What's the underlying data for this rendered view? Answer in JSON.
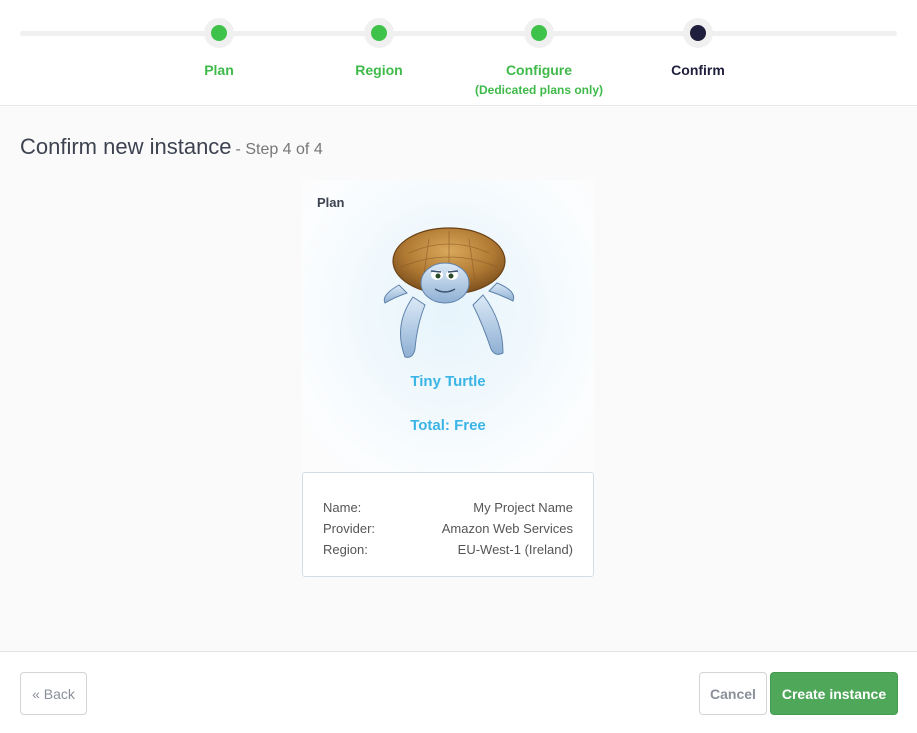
{
  "stepper": {
    "steps": [
      {
        "label": "Plan",
        "sub": "",
        "state": "done"
      },
      {
        "label": "Region",
        "sub": "",
        "state": "done"
      },
      {
        "label": "Configure",
        "sub": "(Dedicated plans only)",
        "state": "done"
      },
      {
        "label": "Confirm",
        "sub": "",
        "state": "active"
      }
    ]
  },
  "heading": {
    "title": "Confirm new instance",
    "step_text": "- Step 4 of 4"
  },
  "plan_card": {
    "label": "Plan",
    "plan_name": "Tiny Turtle",
    "total": "Total: Free",
    "image": "turtle-mascot"
  },
  "details": {
    "rows": [
      {
        "key": "Name:",
        "value": "My Project Name"
      },
      {
        "key": "Provider:",
        "value": "Amazon Web Services"
      },
      {
        "key": "Region:",
        "value": "EU-West-1 (Ireland)"
      }
    ]
  },
  "footer": {
    "back_label": "« Back",
    "cancel_label": "Cancel",
    "create_label": "Create instance"
  },
  "colors": {
    "done": "#3fc24a",
    "active": "#1f1f3d",
    "accent": "#3bb4e6",
    "primary_button": "#4fa75a"
  }
}
